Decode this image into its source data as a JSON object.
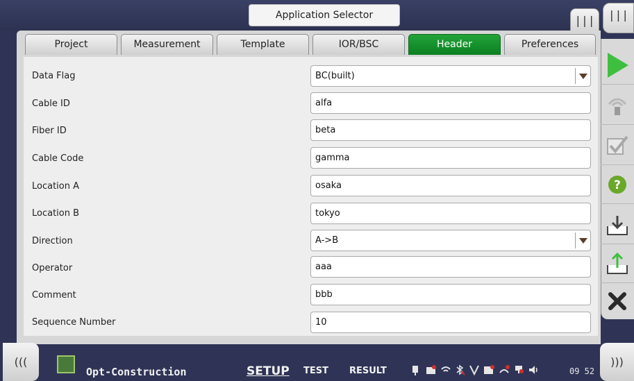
{
  "header": {
    "app_selector": "Application Selector",
    "menu_icon": "|||"
  },
  "tabs": [
    {
      "label": "Project"
    },
    {
      "label": "Measurement"
    },
    {
      "label": "Template"
    },
    {
      "label": "IOR/BSC"
    },
    {
      "label": "Header",
      "active": true
    },
    {
      "label": "Preferences"
    }
  ],
  "rows": [
    {
      "label": "Data Flag",
      "value": "BC(built)",
      "type": "select"
    },
    {
      "label": "Cable ID",
      "value": "alfa",
      "type": "text"
    },
    {
      "label": "Fiber ID",
      "value": "beta",
      "type": "text"
    },
    {
      "label": "Cable Code",
      "value": "gamma",
      "type": "text"
    },
    {
      "label": "Location A",
      "value": "osaka",
      "type": "text"
    },
    {
      "label": "Location B",
      "value": "tokyo",
      "type": "text"
    },
    {
      "label": "Direction",
      "value": "A->B",
      "type": "select"
    },
    {
      "label": "Operator",
      "value": "aaa",
      "type": "text"
    },
    {
      "label": "Comment",
      "value": "bbb",
      "type": "text"
    },
    {
      "label": "Sequence Number",
      "value": "10",
      "type": "text"
    }
  ],
  "sidebar": {
    "icons": [
      "play-icon",
      "laser-icon",
      "checkmark-icon",
      "help-icon",
      "download-icon",
      "upload-icon",
      "close-icon"
    ]
  },
  "bottom": {
    "left_nav": "(((",
    "right_nav": ")))",
    "app_name": "Opt-Construction",
    "setup": "SETUP",
    "test": "TEST",
    "result": "RESULT",
    "clock": "09 52"
  },
  "colors": {
    "active_tab": "#0b7f20",
    "play_green": "#3fbf3f",
    "help_green": "#6aa82a",
    "background": "#2f3456"
  }
}
